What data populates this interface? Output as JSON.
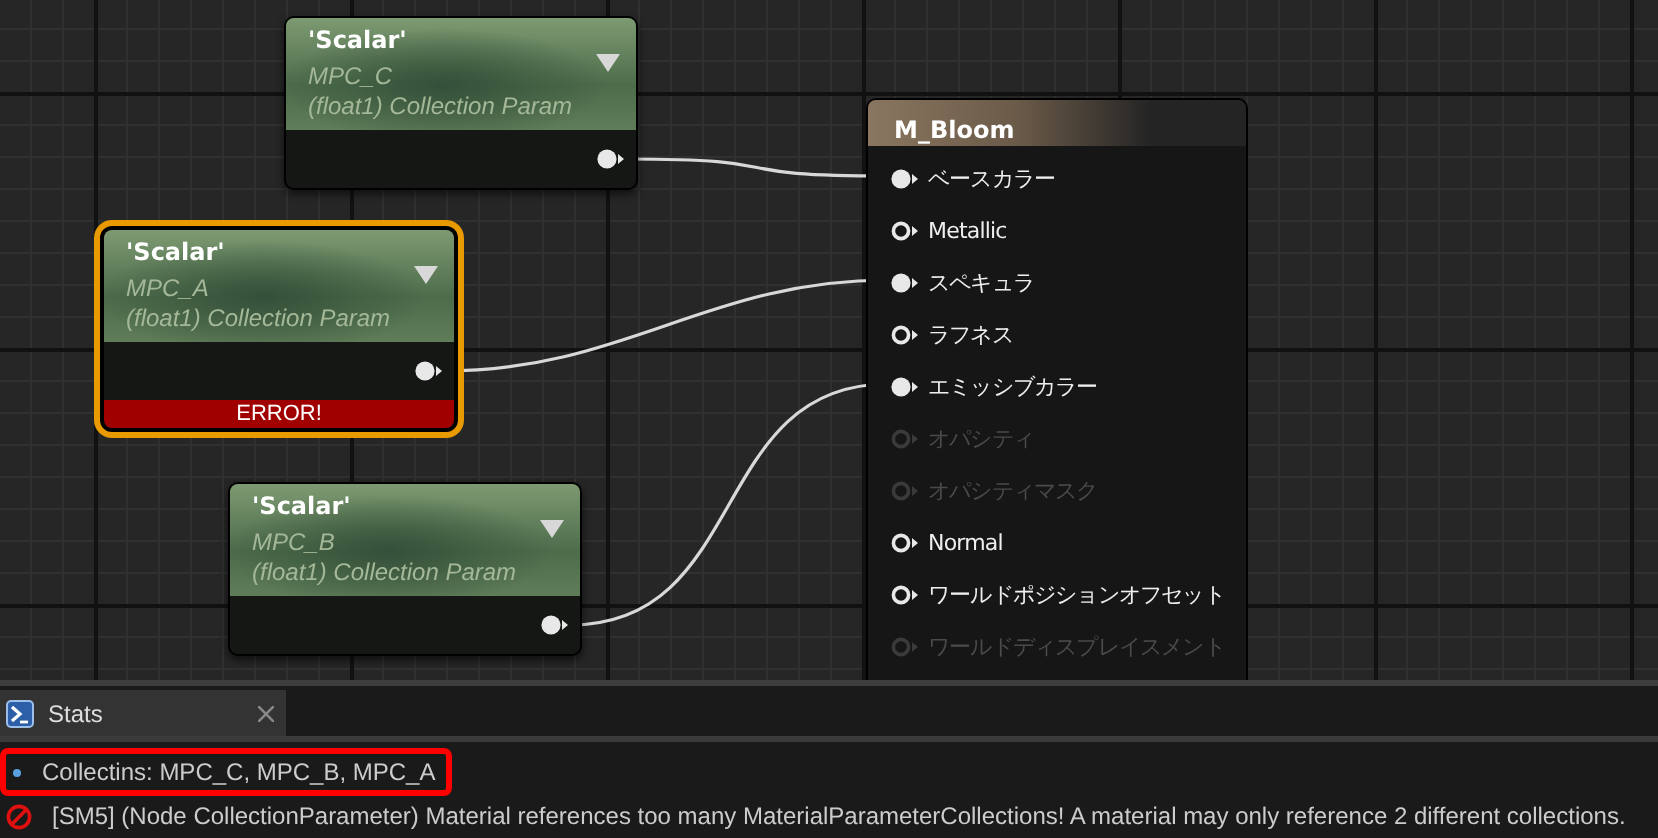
{
  "graph": {
    "nodes": [
      {
        "title": "'Scalar'",
        "collection": "MPC_C",
        "type": "(float1) Collection Param",
        "selected": false
      },
      {
        "title": "'Scalar'",
        "collection": "MPC_A",
        "type": "(float1) Collection Param",
        "selected": true,
        "error": "ERROR!"
      },
      {
        "title": "'Scalar'",
        "collection": "MPC_B",
        "type": "(float1) Collection Param",
        "selected": false
      }
    ],
    "material": {
      "title": "M_Bloom",
      "inputs": [
        {
          "label": "ベースカラー",
          "connected": true,
          "disabled": false
        },
        {
          "label": "Metallic",
          "connected": false,
          "disabled": false
        },
        {
          "label": "スペキュラ",
          "connected": true,
          "disabled": false
        },
        {
          "label": "ラフネス",
          "connected": false,
          "disabled": false
        },
        {
          "label": "エミッシブカラー",
          "connected": true,
          "disabled": false
        },
        {
          "label": "オパシティ",
          "connected": false,
          "disabled": true
        },
        {
          "label": "オパシティマスク",
          "connected": false,
          "disabled": true
        },
        {
          "label": "Normal",
          "connected": false,
          "disabled": false
        },
        {
          "label": "ワールドポジションオフセット",
          "connected": false,
          "disabled": false
        },
        {
          "label": "ワールドディスプレイスメント",
          "connected": false,
          "disabled": true
        }
      ]
    }
  },
  "stats_panel": {
    "tab": {
      "label": "Stats",
      "selected": true
    },
    "messages": [
      {
        "kind": "info",
        "text": "Collectins: MPC_C, MPC_B, MPC_A",
        "highlighted": true
      },
      {
        "kind": "error",
        "text": "[SM5] (Node CollectionParameter) Material references too many MaterialParameterCollections!  A material may only reference 2 different collections.",
        "highlighted": false
      }
    ]
  }
}
